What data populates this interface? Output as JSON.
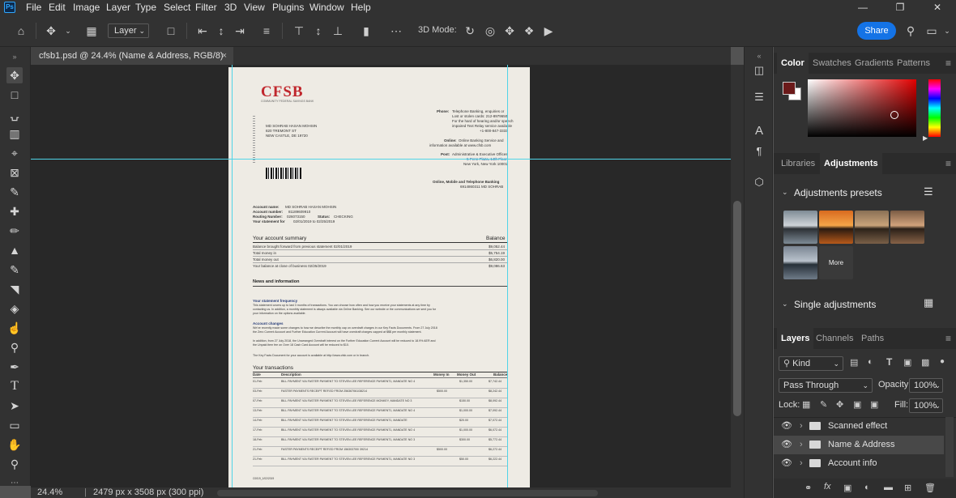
{
  "menubar": {
    "logo": "Ps",
    "items": [
      "File",
      "Edit",
      "Image",
      "Layer",
      "Type",
      "Select",
      "Filter",
      "3D",
      "View",
      "Plugins",
      "Window",
      "Help"
    ]
  },
  "options": {
    "layer_select": "Layer",
    "mode_3d": "3D Mode:",
    "share": "Share"
  },
  "document_tab": {
    "title": "cfsb1.psd @ 24.4% (Name & Address, RGB/8)",
    "close": "×"
  },
  "status": {
    "zoom": "24.4%",
    "doc_size": "2479 px x 3508 px (300 ppi)"
  },
  "color_panel": {
    "tabs": [
      "Color",
      "Swatches",
      "Gradients",
      "Patterns"
    ],
    "foreground": "#6b1a1a",
    "background": "#ffffff"
  },
  "adjust_panel": {
    "tabs": [
      "Libraries",
      "Adjustments"
    ],
    "presets_title": "Adjustments presets",
    "more": "More",
    "single_title": "Single adjustments"
  },
  "layers_panel": {
    "tabs": [
      "Layers",
      "Channels",
      "Paths"
    ],
    "kind": "Kind",
    "blend_mode": "Pass Through",
    "opacity_label": "Opacity:",
    "opacity": "100%",
    "lock_label": "Lock:",
    "fill_label": "Fill:",
    "fill": "100%",
    "layers": [
      {
        "name": "Scanned effect",
        "selected": false
      },
      {
        "name": "Name & Address",
        "selected": true
      },
      {
        "name": "Account info",
        "selected": false
      }
    ]
  },
  "statement": {
    "bank_logo": "CFSB",
    "bank_sub": "COMMUNITY FEDERAL SAVINGS BANK",
    "customer_lines": [
      "MD SOHRAB HASAN MOHSIN",
      "820 TREMONT ST",
      "NEW CASTLE, DE 19720"
    ],
    "contact_phone_label": "Phone:",
    "contact_phone": [
      "Telephone Banking, enquiries or",
      "Lost or stolen cards: 212-8979650",
      "For the hard of hearing and/or speech",
      "impaired Text Relay service available",
      "+1-800-847-3333"
    ],
    "contact_online_label": "Online:",
    "contact_online": [
      "Online Banking Service and",
      "information available at www.cfsb.com"
    ],
    "contact_post_label": "Post:",
    "contact_post": [
      "Administrative & Executive Offices",
      "5 Penn Plaza, 14th Floor",
      "New York, New York 10001"
    ],
    "online_title": "Online, Mobile and Telephone Banking",
    "online_id": "6914860311 MD SOHRAB",
    "account_name_label": "Account name:",
    "account_name": "MD SOHRAB HASAN MOHSIN",
    "account_number_label": "Account number:",
    "account_number": "81189609910",
    "routing_label": "Routing Number:",
    "routing": "026073150",
    "status_label": "Status:",
    "status": "CHECKING",
    "statement_for_label": "Your statement for",
    "statement_for": "02/01/2019 to 02/25/2019",
    "summary_title": "Your account summary",
    "summary_balance": "Balance",
    "summary_rows": [
      {
        "label": "Balance brought forward from previous statement 02/01/2019",
        "value": "$9,052.44"
      },
      {
        "label": "Total money in",
        "value": "$5,754.19"
      },
      {
        "label": "Total money out",
        "value": "$6,820.00"
      },
      {
        "label": "Your balance at close of business 02/25/2019",
        "value": "$9,086.63"
      }
    ],
    "news_title": "News and information",
    "freq_title": "Your statement frequency",
    "freq_lines": [
      "This statement covers up to last 3 months of transactions. You can choose how often and how you receive your statements at any time by",
      "contacting us. In addition, a monthly statement is always available via Online Banking. See our website or the communications we sent you for",
      "your information on the options available."
    ],
    "changes_title": "Account changes",
    "changes_lines": [
      "We've recently made some changes to how we describe the monthly cap on overdraft charges in our Key Facts Documents. From 27 July 2018",
      "the Zero Current Account and Further Education Current Account will have overdraft charges capped at $$$ per monthly statement."
    ],
    "changes_lines2": [
      "In addition, from 27 July 2018, the Unarranged Overdraft interest on the Further Education Current Account will be reduced to 18.9% AER and",
      "the Unpaid item fee on Over 18 Cash Card Account will be reduced to $10."
    ],
    "keyfacts_line": "The Key Facts Document for your account is available at http://www.cfsb.com or in branch.",
    "tx_title": "Your transactions",
    "tx_headers": [
      "Date",
      "Description",
      "Money In",
      "Money Out",
      "Balance"
    ],
    "transactions": [
      {
        "date": "01-Feb",
        "desc": "BILL PAYMENT VIA FASTER PAYMENT TO STEVEN LEE REFERENCE PAYMENT1, MANDATE NO 4",
        "in": "",
        "out": "$1,350.00",
        "bal": "$7,742.44"
      },
      {
        "date": "03-Feb",
        "desc": "FASTER PAYMENTS RECEIPT REF.ED FROM 256367061/38214",
        "in": "$500.00",
        "out": "",
        "bal": "$8,242.44"
      },
      {
        "date": "07-Feb",
        "desc": "BILL PAYMENT VIA FASTER PAYMENT TO STEVEN LEE REFERENCE MONKEY, MANDATE NO 3",
        "in": "",
        "out": "$150.00",
        "bal": "$8,092.44"
      },
      {
        "date": "13-Feb",
        "desc": "BILL PAYMENT VIA FASTER PAYMENT TO STEVEN LEE REFERENCE PAYMENT1, MANDATE NO 4",
        "in": "",
        "out": "$1,000.00",
        "bal": "$7,092.44"
      },
      {
        "date": "14-Feb",
        "desc": "BILL PAYMENT VIA FASTER PAYMENT TO STEVEN LEE REFERENCE PAYMENT1, MANDATE",
        "in": "",
        "out": "$20.00",
        "bal": "$7,072.44"
      },
      {
        "date": "17-Feb",
        "desc": "BILL PAYMENT VIA FASTER PAYMENT TO STEVEN LEE REFERENCE PAYMENT1, MANDATE NO 4",
        "in": "",
        "out": "$1,000.00",
        "bal": "$6,072.44"
      },
      {
        "date": "18-Feb",
        "desc": "BILL PAYMENT VIA FASTER PAYMENT TO STEVEN LEE REFERENCE PAYMENT1, MANDATE NO 3",
        "in": "",
        "out": "$300.00",
        "bal": "$5,772.44"
      },
      {
        "date": "21-Feb",
        "desc": "FASTER PAYMENTS RECEIPT REF.ED FROM 156303700/ 39214",
        "in": "$500.00",
        "out": "",
        "bal": "$6,272.44"
      },
      {
        "date": "21-Feb",
        "desc": "BILL PAYMENT VIA FASTER PAYMENT TO STEVEN LEE REFERENCE PAYMENT1, MANDATE NO 3",
        "in": "",
        "out": "$50.00",
        "bal": "$6,222.44"
      }
    ],
    "footer_code": "C0019_1/02/2019"
  }
}
